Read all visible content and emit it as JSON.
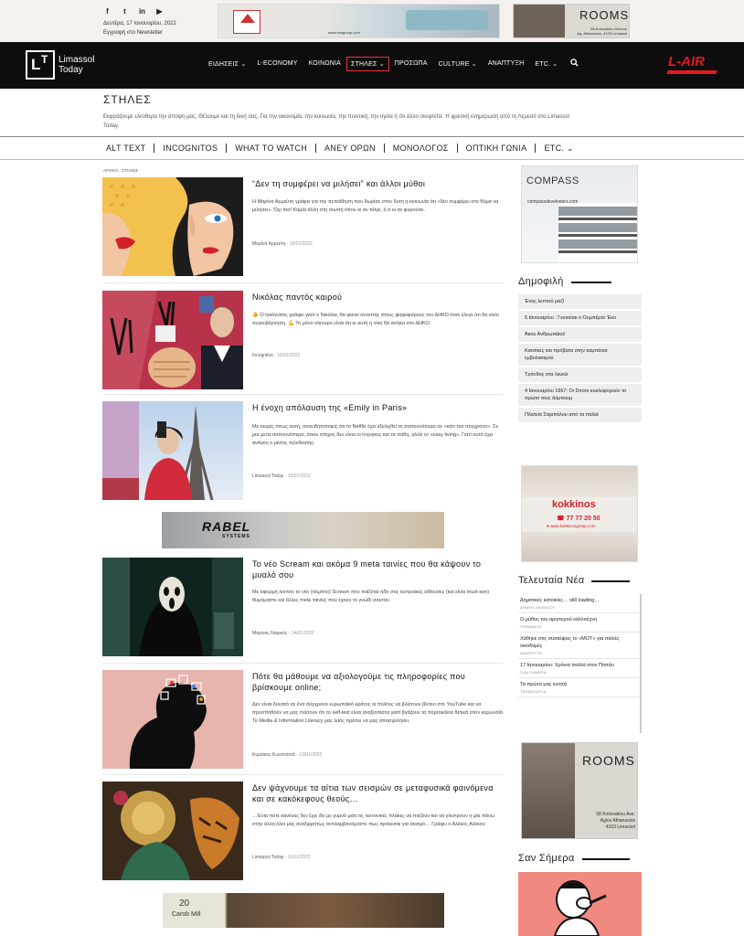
{
  "topbar": {
    "social_icons": [
      "facebook-icon",
      "twitter-icon",
      "linkedin-icon",
      "youtube-icon"
    ],
    "social_glyphs": [
      "f",
      "t",
      "in",
      "▶"
    ],
    "date": "Δευτέρα, 17 Ιανουαρίου, 2022",
    "newsletter": "Εγγραφή στο Newsletter",
    "ad_top_url": "www.ekagroup.com",
    "rooms_ad": {
      "title": "ROOMS",
      "address_line1": "58 Kolonakiou Avenue",
      "address_line2": "Ag. Athanasios, 4103 Limassol"
    }
  },
  "brand": {
    "line1": "Limassol",
    "line2": "Today"
  },
  "nav": {
    "items": [
      "ΕΙΔΗΣΕΙΣ ⌄",
      "L-ECONOMY",
      "ΚΟΙΝΩΝΙΑ",
      "ΣΤΗΛΕΣ ⌄",
      "ΠΡΟΣΩΠΑ",
      "CULTURE ⌄",
      "ΑΝΑΠΤΥΞΗ",
      "ETC. ⌄"
    ],
    "active_index": 3,
    "lair": "L-AIR"
  },
  "section": {
    "title": "ΣΤΗΛΕΣ",
    "description": "Εκφράζουμε ελεύθερα την άποψη μας. Θέλουμε και τη δική σας. Για την οικονομία, την κοινωνία, την πολιτική, την υγεία ή ότι άλλο σκεφτείτε. Η φρεσκή ενημέρωση από τη Λεμεσό στο Limassol Today."
  },
  "subnav": [
    "ALT TEXT",
    "INCOGNITOS",
    "WHAT TO WATCH",
    "ΑΝΕΥ ΟΡΩΝ",
    "ΜΟΝΟΛΟΓΟΣ",
    "ΟΠΤΙΚΗ ΓΩΝΙΑ",
    "ETC. ⌄"
  ],
  "breadcrumb": "ΑΡΧΙΚΗ › ΣΤΗΛΕΣ",
  "articles": [
    {
      "title": "“Δεν τη συμφέρει να μιλήσει” και άλλοι μύθοι",
      "excerpt": "Η Μαρίνα Αρμεύτη γράφει για την πεποίθηση που δωρίσε στον θυτη η κοινωνία ότι «δεν συμφέρει στο θύμα να μιλήσει». Όχι πια! Καμία άλλη στη σιωπή όπου κι αν πάγε, ό,τι κι αν φορούσε.",
      "author": "Μαρίνα Αρμεύτη",
      "date": "18/01/2022"
    },
    {
      "title": "Νικόλας παντός καιρού",
      "excerpt": "🫵 Ο Ιγκόγνιτος γράφει γιατί ο Νικόλας θα φανεί συνεπής στους ψηφοφόρους του ΔΗΚΟ όταν έλεγε ότι θα είναι συγκυβέρνηση. 💪 Το μόνο σίγουρο είναι ότι κι αυτή η νίκη θα ανήκει στο ΔΗΚΟ.",
      "author": "Incognitos",
      "date": "16/01/2022"
    },
    {
      "title": "Η ένοχη απόλαυση της «Emily in Paris»",
      "excerpt": "Με σειρές όπως αυτή, συνειδητοποιείς ότι το Netflix έχει εξελιχθεί τη σαπουνόπερα σε «κάτι πιο σύγχρονο». Σε μια μετα-σαπουνόπερα, όπου στόχος δεν είναι οι ίντριγκες και τα πάθη, αλλά το «easy living». Γιατί αυτό έχει ανάγκη ο μέσος τηλεθεατής.",
      "author": "Limassol Today",
      "date": "15/01/2022"
    },
    {
      "title": "Το νέο Scream και ακόμα 9 meta ταινίες που θα κάψουν το μυαλό σου",
      "excerpt": "Με αφορμή λοιπόν το νέο (πέμπτο) Scream που παίζεται ήδη στις κυπριακές αίθουσες (και είναι must-see) θυμόμαστε και άλλες meta ταινίες που έχουν το γνώθι σαυτόν.",
      "author": "Μαρίνος Νομικός",
      "date": "14/01/2022"
    },
    {
      "title": "Πότε θα μάθουμε να αξιολογούμε τις πληροφορίες που βρίσκουμε online;",
      "excerpt": "Δεν είναι δυνατό σε ένα σύγχρονο ευρωπαϊκό κράτος οι πολίτες να βλέπουν βίντεο στο YouTube και να προσπαθούν να μας πείσουν ότι το self-test είναι αναξιόπιστα γιατί βγάζουν τα πορτοκάλια θετικά στον κορωνοϊό. Το Media & Information Literacy μας λαός πρέπει να μας απασχολήσει.",
      "author": "Κυριάκος Κωνσταντά",
      "date": "13/01/2022"
    },
    {
      "title": "Δεν ψάχνουμε τα αίτια των σεισμών σε μεταφυσικά φαινόμενα και σε κακόκεφους θεούς…",
      "excerpt": "…Ένια ποτέ κανένας δεν έχει δει με γυμνό μάτι τις τεκτονικές πλάκες να πιέζουν και να γλιστρουν η μία πάνω στην άλλη όλοι μας αναξιρρήτως αντιλαμβανόμαστε πως πρόκειται για σεισμό… Γράφει ο Αλέκος Αλέκου",
      "author": "Limassol Today",
      "date": "11/01/2022"
    }
  ],
  "ads": {
    "mid_brand": "RABEL",
    "mid_sub": "SYSTEMS",
    "bottom_number": "20",
    "bottom_name": "Carob Mill"
  },
  "sidebar": {
    "compass": {
      "name": "COMPASS",
      "url": "compassdevelopers.com"
    },
    "popular_heading": "Δημοφιλή",
    "popular": [
      "Ένος λεπτού μαζί",
      "5 Ιανουαρίου : Γεννιέται ο Ουμπέρτο Έκο",
      "Άκου Ανθρωπάκο!",
      "Κατσίκες και πρόβατα στην καμπάνια εμβολιασμού",
      "Τρόοδος στα λευκά",
      "4 Ιανουαρίου 1967: Οι Doors κυκλοφορούν το πρώτο τους άλμπουμ",
      "Πλατεία Σαριπόλου από τα παλιά"
    ],
    "kokkinos": {
      "logo": "kokkinos",
      "tel": "☎ 77 77 20 50",
      "web": "● www.kokkinosgroup.com"
    },
    "latest_heading": "Τελευταία Νέα",
    "latest": [
      {
        "title": "Δημοτικές κατοικίες… still loading…",
        "category": "ΔΗΜΟΣ ΛΕΜΕΣΟΥ"
      },
      {
        "title": "Ο μύθος του αριστερού καλλιτέχνη",
        "category": "ΓΡΑΜΜΑΤΑ"
      },
      {
        "title": "Χάθηκε στις συσκέψεις το «ΜΟΤ» για παλιές οικοδομές",
        "category": "ΑΝΑΠΤΥΞΗ"
      },
      {
        "title": "17 Ιανουαρίου: Χρόνια πολλά στον Ποπάυ",
        "category": "ΣΑΝ ΣΗΜΕΡΑ"
      },
      {
        "title": "Τα πρώτα μας κινητά",
        "category": "ΤΕΧΝΟΛΟΓΙΑ"
      }
    ],
    "rooms": {
      "title": "ROOMS",
      "addr1": "58 Kolonakiou Ave.",
      "addr2": "Agios Athanasios",
      "addr3": "4103 Limassol"
    },
    "today_heading": "Σαν Σήμερα"
  }
}
